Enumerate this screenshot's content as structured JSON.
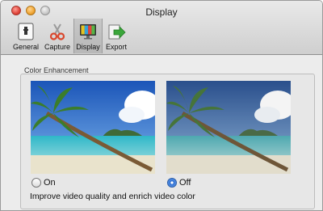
{
  "window": {
    "title": "Display"
  },
  "toolbar": {
    "items": [
      {
        "label": "General",
        "icon": "general-icon",
        "selected": false
      },
      {
        "label": "Capture",
        "icon": "scissors-icon",
        "selected": false
      },
      {
        "label": "Display",
        "icon": "monitor-icon",
        "selected": true
      },
      {
        "label": "Export",
        "icon": "export-arrow-icon",
        "selected": false
      }
    ]
  },
  "color_enhancement": {
    "group_title": "Color Enhancement",
    "options": [
      {
        "label": "On",
        "selected": false
      },
      {
        "label": "Off",
        "selected": true
      }
    ],
    "description": "Improve video quality and enrich video color"
  },
  "colors": {
    "radio_selected": "#2f6fd1",
    "toolbar_selected": "#c0c0c0"
  }
}
